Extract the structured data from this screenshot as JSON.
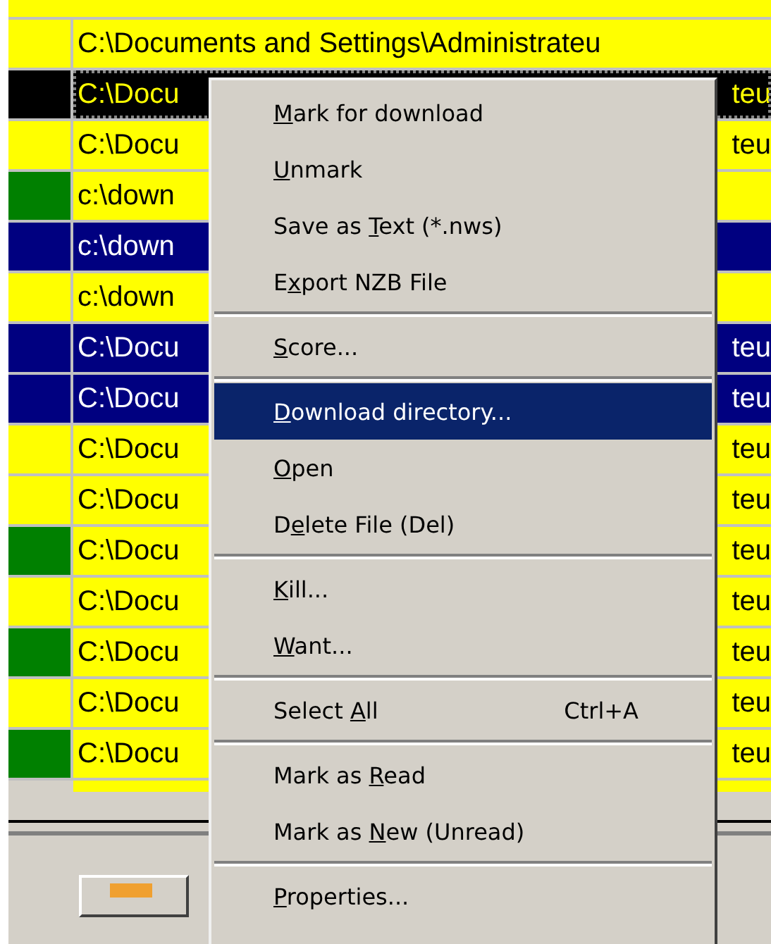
{
  "file_list": {
    "rows": [
      {
        "color": "#ffff00",
        "selected": false,
        "focused": false,
        "text": "C:\\Documents and Settings\\Administrateu"
      },
      {
        "color": "#000000",
        "selected": false,
        "focused": true,
        "text": "C:\\Docu",
        "text_right": "teu"
      },
      {
        "color": "#ffff00",
        "selected": false,
        "focused": false,
        "text": "C:\\Docu",
        "text_right": "teu"
      },
      {
        "color": "#008000",
        "selected": false,
        "focused": false,
        "text": "c:\\down"
      },
      {
        "color": "#000080",
        "selected": true,
        "focused": false,
        "text": "c:\\down"
      },
      {
        "color": "#ffff00",
        "selected": false,
        "focused": false,
        "text": "c:\\down"
      },
      {
        "color": "#000080",
        "selected": true,
        "focused": false,
        "text": "C:\\Docu",
        "text_right": "teu"
      },
      {
        "color": "#000080",
        "selected": true,
        "focused": false,
        "text": "C:\\Docu",
        "text_right": "teu"
      },
      {
        "color": "#ffff00",
        "selected": false,
        "focused": false,
        "text": "C:\\Docu",
        "text_right": "teu"
      },
      {
        "color": "#ffff00",
        "selected": false,
        "focused": false,
        "text": "C:\\Docu",
        "text_right": "teu"
      },
      {
        "color": "#008000",
        "selected": false,
        "focused": false,
        "text": "C:\\Docu",
        "text_right": "teu"
      },
      {
        "color": "#ffff00",
        "selected": false,
        "focused": false,
        "text": "C:\\Docu",
        "text_right": "teu"
      },
      {
        "color": "#008000",
        "selected": false,
        "focused": false,
        "text": "C:\\Docu",
        "text_right": "teu"
      },
      {
        "color": "#ffff00",
        "selected": false,
        "focused": false,
        "text": "C:\\Docu",
        "text_right": "teu"
      },
      {
        "color": "#008000",
        "selected": false,
        "focused": false,
        "text": "C:\\Docu",
        "text_right": "teu"
      }
    ]
  },
  "context_menu": {
    "entries": [
      {
        "kind": "item",
        "selected": false,
        "label": {
          "key": "M",
          "post": "ark for download"
        }
      },
      {
        "kind": "item",
        "selected": false,
        "label": {
          "key": "U",
          "post": "nmark"
        }
      },
      {
        "kind": "item",
        "selected": false,
        "label": {
          "pre": "Save as ",
          "key": "T",
          "post": "ext (*.nws)"
        }
      },
      {
        "kind": "item",
        "selected": false,
        "label": {
          "pre": "E",
          "key": "x",
          "post": "port NZB File"
        }
      },
      {
        "kind": "separator"
      },
      {
        "kind": "item",
        "selected": false,
        "label": {
          "key": "S",
          "post": "core..."
        }
      },
      {
        "kind": "separator"
      },
      {
        "kind": "item",
        "selected": true,
        "label": {
          "key": "D",
          "post": "ownload directory..."
        }
      },
      {
        "kind": "item",
        "selected": false,
        "label": {
          "key": "O",
          "post": "pen"
        }
      },
      {
        "kind": "item",
        "selected": false,
        "label": {
          "pre": "D",
          "key": "e",
          "post": "lete File (Del)"
        }
      },
      {
        "kind": "separator"
      },
      {
        "kind": "item",
        "selected": false,
        "label": {
          "key": "K",
          "post": "ill..."
        }
      },
      {
        "kind": "item",
        "selected": false,
        "label": {
          "key": "W",
          "post": "ant..."
        }
      },
      {
        "kind": "separator"
      },
      {
        "kind": "item",
        "selected": false,
        "label": {
          "pre": "Select ",
          "key": "A",
          "post": "ll"
        },
        "shortcut": "Ctrl+A"
      },
      {
        "kind": "separator"
      },
      {
        "kind": "item",
        "selected": false,
        "label": {
          "pre": "Mark as ",
          "key": "R",
          "post": "ead"
        }
      },
      {
        "kind": "item",
        "selected": false,
        "label": {
          "pre": "Mark as ",
          "key": "N",
          "post": "ew (Unread)"
        }
      },
      {
        "kind": "separator"
      },
      {
        "kind": "item",
        "selected": false,
        "label": {
          "key": "P",
          "post": "roperties..."
        }
      }
    ]
  }
}
